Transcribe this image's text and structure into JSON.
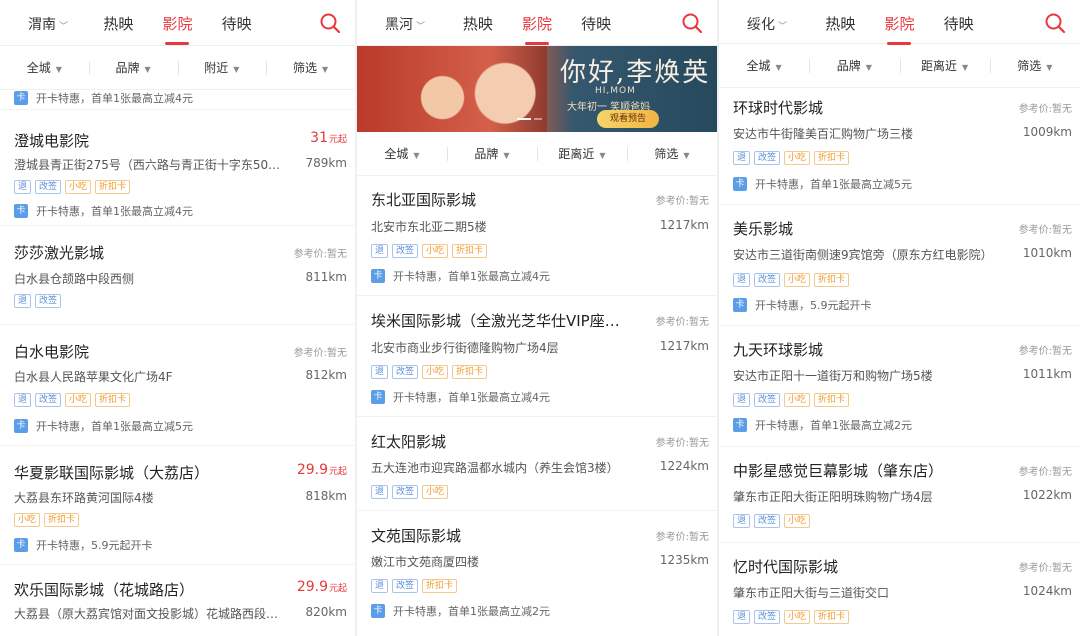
{
  "colors": {
    "accent": "#e8383d",
    "tag_blue": "#5a8fd6",
    "tag_orange": "#f09a2a"
  },
  "panels": [
    {
      "city": "渭南",
      "tabs": [
        "热映",
        "影院",
        "待映"
      ],
      "filters": [
        "全城",
        "品牌",
        "附近",
        "筛选"
      ],
      "top_promo": "开卡特惠，首单1张最高立减4元",
      "cinemas": [
        {
          "name": "澄城电影院",
          "price": "31",
          "price_suffix": "元起",
          "address": "澄城县青正街275号（西六路与青正街十字东50…",
          "distance": "789km",
          "tags": [
            "退",
            "改签",
            "小吃",
            "折扣卡"
          ],
          "promo": "开卡特惠，首单1张最高立减4元"
        },
        {
          "name": "莎莎激光影城",
          "ref_price": "参考价:暂无",
          "address": "白水县仓颉路中段西侧",
          "distance": "811km",
          "tags": [
            "退",
            "改签"
          ]
        },
        {
          "name": "白水电影院",
          "ref_price": "参考价:暂无",
          "address": "白水县人民路苹果文化广场4F",
          "distance": "812km",
          "tags": [
            "退",
            "改签",
            "小吃",
            "折扣卡"
          ],
          "promo": "开卡特惠，首单1张最高立减5元"
        },
        {
          "name": "华夏影联国际影城（大荔店）",
          "price": "29.9",
          "price_suffix": "元起",
          "address": "大荔县东环路黄河国际4楼",
          "distance": "818km",
          "tags": [
            "小吃",
            "折扣卡"
          ],
          "promo": "开卡特惠，5.9元起开卡"
        },
        {
          "name": "欢乐国际影城（花城路店）",
          "price": "29.9",
          "price_suffix": "元起",
          "address": "大荔县（原大荔宾馆对面文投影城）花城路西段…",
          "distance": "820km",
          "tags": []
        }
      ]
    },
    {
      "city": "黑河",
      "tabs": [
        "热映",
        "影院",
        "待映"
      ],
      "banner": {
        "title": "你好,李焕英",
        "en": "HI,MOM",
        "subtitle": "大年初一 笑顺爸妈",
        "button": "观看预告"
      },
      "filters": [
        "全城",
        "品牌",
        "距离近",
        "筛选"
      ],
      "cinemas": [
        {
          "name": "东北亚国际影城",
          "ref_price": "参考价:暂无",
          "address": "北安市东北亚二期5楼",
          "distance": "1217km",
          "tags": [
            "退",
            "改签",
            "小吃",
            "折扣卡"
          ],
          "promo": "开卡特惠，首单1张最高立减4元"
        },
        {
          "name": "埃米国际影城（全激光芝华仕VIP座…",
          "ref_price": "参考价:暂无",
          "address": "北安市商业步行街德隆购物广场4层",
          "distance": "1217km",
          "tags": [
            "退",
            "改签",
            "小吃",
            "折扣卡"
          ],
          "promo": "开卡特惠，首单1张最高立减4元"
        },
        {
          "name": "红太阳影城",
          "ref_price": "参考价:暂无",
          "address": "五大连池市迎宾路温都水城内（养生会馆3楼）",
          "distance": "1224km",
          "tags": [
            "退",
            "改签",
            "小吃"
          ]
        },
        {
          "name": "文苑国际影城",
          "ref_price": "参考价:暂无",
          "address": "嫩江市文苑商厦四楼",
          "distance": "1235km",
          "tags": [
            "退",
            "改签",
            "折扣卡"
          ],
          "promo": "开卡特惠，首单1张最高立减2元"
        }
      ]
    },
    {
      "city": "绥化",
      "tabs": [
        "热映",
        "影院",
        "待映"
      ],
      "filters": [
        "全城",
        "品牌",
        "距离近",
        "筛选"
      ],
      "cinemas": [
        {
          "name": "环球时代影城",
          "ref_price": "参考价:暂无",
          "address": "安达市牛街隆美百汇购物广场三楼",
          "distance": "1009km",
          "tags": [
            "退",
            "改签",
            "小吃",
            "折扣卡"
          ],
          "promo": "开卡特惠，首单1张最高立减5元"
        },
        {
          "name": "美乐影城",
          "ref_price": "参考价:暂无",
          "address": "安达市三道街南侧速9宾馆旁（原东方红电影院）",
          "distance": "1010km",
          "tags": [
            "退",
            "改签",
            "小吃",
            "折扣卡"
          ],
          "promo": "开卡特惠，5.9元起开卡"
        },
        {
          "name": "九天环球影城",
          "ref_price": "参考价:暂无",
          "address": "安达市正阳十一道街万和购物广场5楼",
          "distance": "1011km",
          "tags": [
            "退",
            "改签",
            "小吃",
            "折扣卡"
          ],
          "promo": "开卡特惠，首单1张最高立减2元"
        },
        {
          "name": "中影星感觉巨幕影城（肇东店）",
          "ref_price": "参考价:暂无",
          "address": "肇东市正阳大街正阳明珠购物广场4层",
          "distance": "1022km",
          "tags": [
            "退",
            "改签",
            "小吃"
          ]
        },
        {
          "name": "忆时代国际影城",
          "ref_price": "参考价:暂无",
          "address": "肇东市正阳大街与三道街交口",
          "distance": "1024km",
          "tags": [
            "退",
            "改签",
            "小吃",
            "折扣卡"
          ]
        }
      ]
    }
  ]
}
